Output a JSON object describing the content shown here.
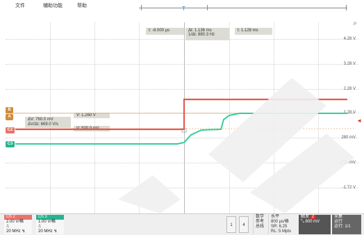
{
  "menu": {
    "items": [
      "文件",
      "辅助功能",
      "帮助"
    ]
  },
  "trigger_marker": "T",
  "cursors": {
    "left": {
      "t": "t:  -8.000 µs"
    },
    "delta": {
      "dt": "Δt:  1.136 ms",
      "freq": "1/Δt:  880.3 Hz"
    },
    "right": {
      "t": "t:  1.128 ms"
    }
  },
  "right_scale": {
    "labels": [
      "4.28 V",
      "3.28 V",
      "2.28 V",
      "1.28 V",
      "280 mV",
      "-720 mV",
      "-1.72 V"
    ],
    "ch2_arrow": "◄"
  },
  "channel_tags": {
    "b": "B",
    "a": "A",
    "c2": "C2",
    "c3": "C3"
  },
  "measurements": {
    "v_upper": "V:  1.260 V",
    "v_lower": "V:  500.0 mV",
    "delta_v": "ΔV:      760.0 mV",
    "delta_slope": "ΔV/Δt: 669.0 V/s"
  },
  "status": {
    "ch2": {
      "name": "Ch 2",
      "scale": "2.00 V/格",
      "coupling": "⎍",
      "bw": "20 MHz ↯",
      "color": "#e8736a"
    },
    "ch3": {
      "name": "Ch 3",
      "scale": "1.00 V/格",
      "coupling": "⎍",
      "bw": "20 MHz ↯",
      "color": "#27b48f"
    },
    "btn_left": "1",
    "btn_right": "4",
    "math": [
      "数学",
      "参考",
      "总线"
    ],
    "horizontal": {
      "title": "水平",
      "scale": "800 µs/格",
      "sr": "SR: 6.25",
      "rl": "RL: 5 Mpts"
    },
    "trigger": {
      "title": "触发",
      "badge": "2",
      "slope": "⤡",
      "level": "800 mV"
    },
    "acq": {
      "title": "采集",
      "mode": "运行",
      "count": "运行: 1/1"
    }
  }
}
